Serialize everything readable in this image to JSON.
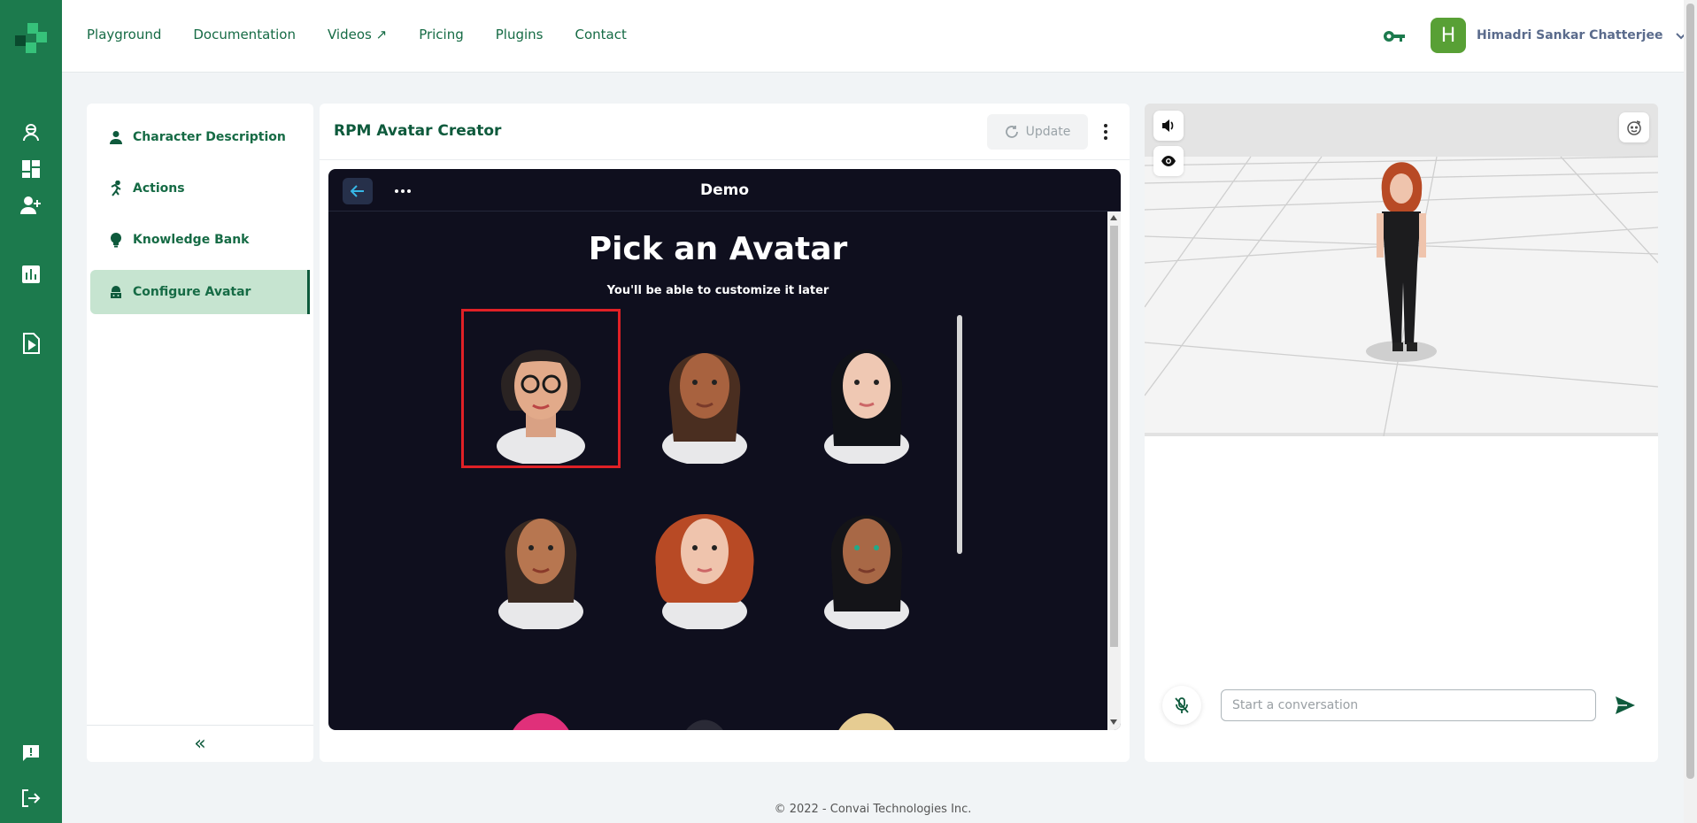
{
  "nav": {
    "items": [
      "Playground",
      "Documentation",
      "Videos ↗",
      "Pricing",
      "Plugins",
      "Contact"
    ]
  },
  "user": {
    "initial": "H",
    "name": "Himadri Sankar Chatterjee"
  },
  "sidebar": {
    "items": [
      {
        "label": "Character Description",
        "icon": "person-icon"
      },
      {
        "label": "Actions",
        "icon": "running-icon"
      },
      {
        "label": "Knowledge Bank",
        "icon": "lightbulb-icon"
      },
      {
        "label": "Configure Avatar",
        "icon": "avatar-config-icon",
        "active": true
      }
    ],
    "collapse_label": "«"
  },
  "center": {
    "title": "RPM Avatar Creator",
    "update_label": "Update"
  },
  "creator": {
    "header_title": "Demo",
    "heading": "Pick an Avatar",
    "subheading": "You'll be able to customize it later",
    "avatars": [
      {
        "name": "dark bob with glasses",
        "selected": true
      },
      {
        "name": "braided dark hair"
      },
      {
        "name": "long black hair"
      },
      {
        "name": "long brown hair"
      },
      {
        "name": "curly red hair"
      },
      {
        "name": "long black hair tan skin"
      },
      {
        "name": "pink hair"
      },
      {
        "name": "dark hair bun"
      },
      {
        "name": "blonde hair"
      }
    ]
  },
  "chat": {
    "placeholder": "Start a conversation"
  },
  "footer": {
    "text": "© 2022 - Convai Technologies Inc."
  },
  "colors": {
    "brand_green": "#1c7a4d",
    "text_green": "#0e5a3c",
    "active_bg": "#c6e4d0",
    "selection_red": "#e02026"
  }
}
